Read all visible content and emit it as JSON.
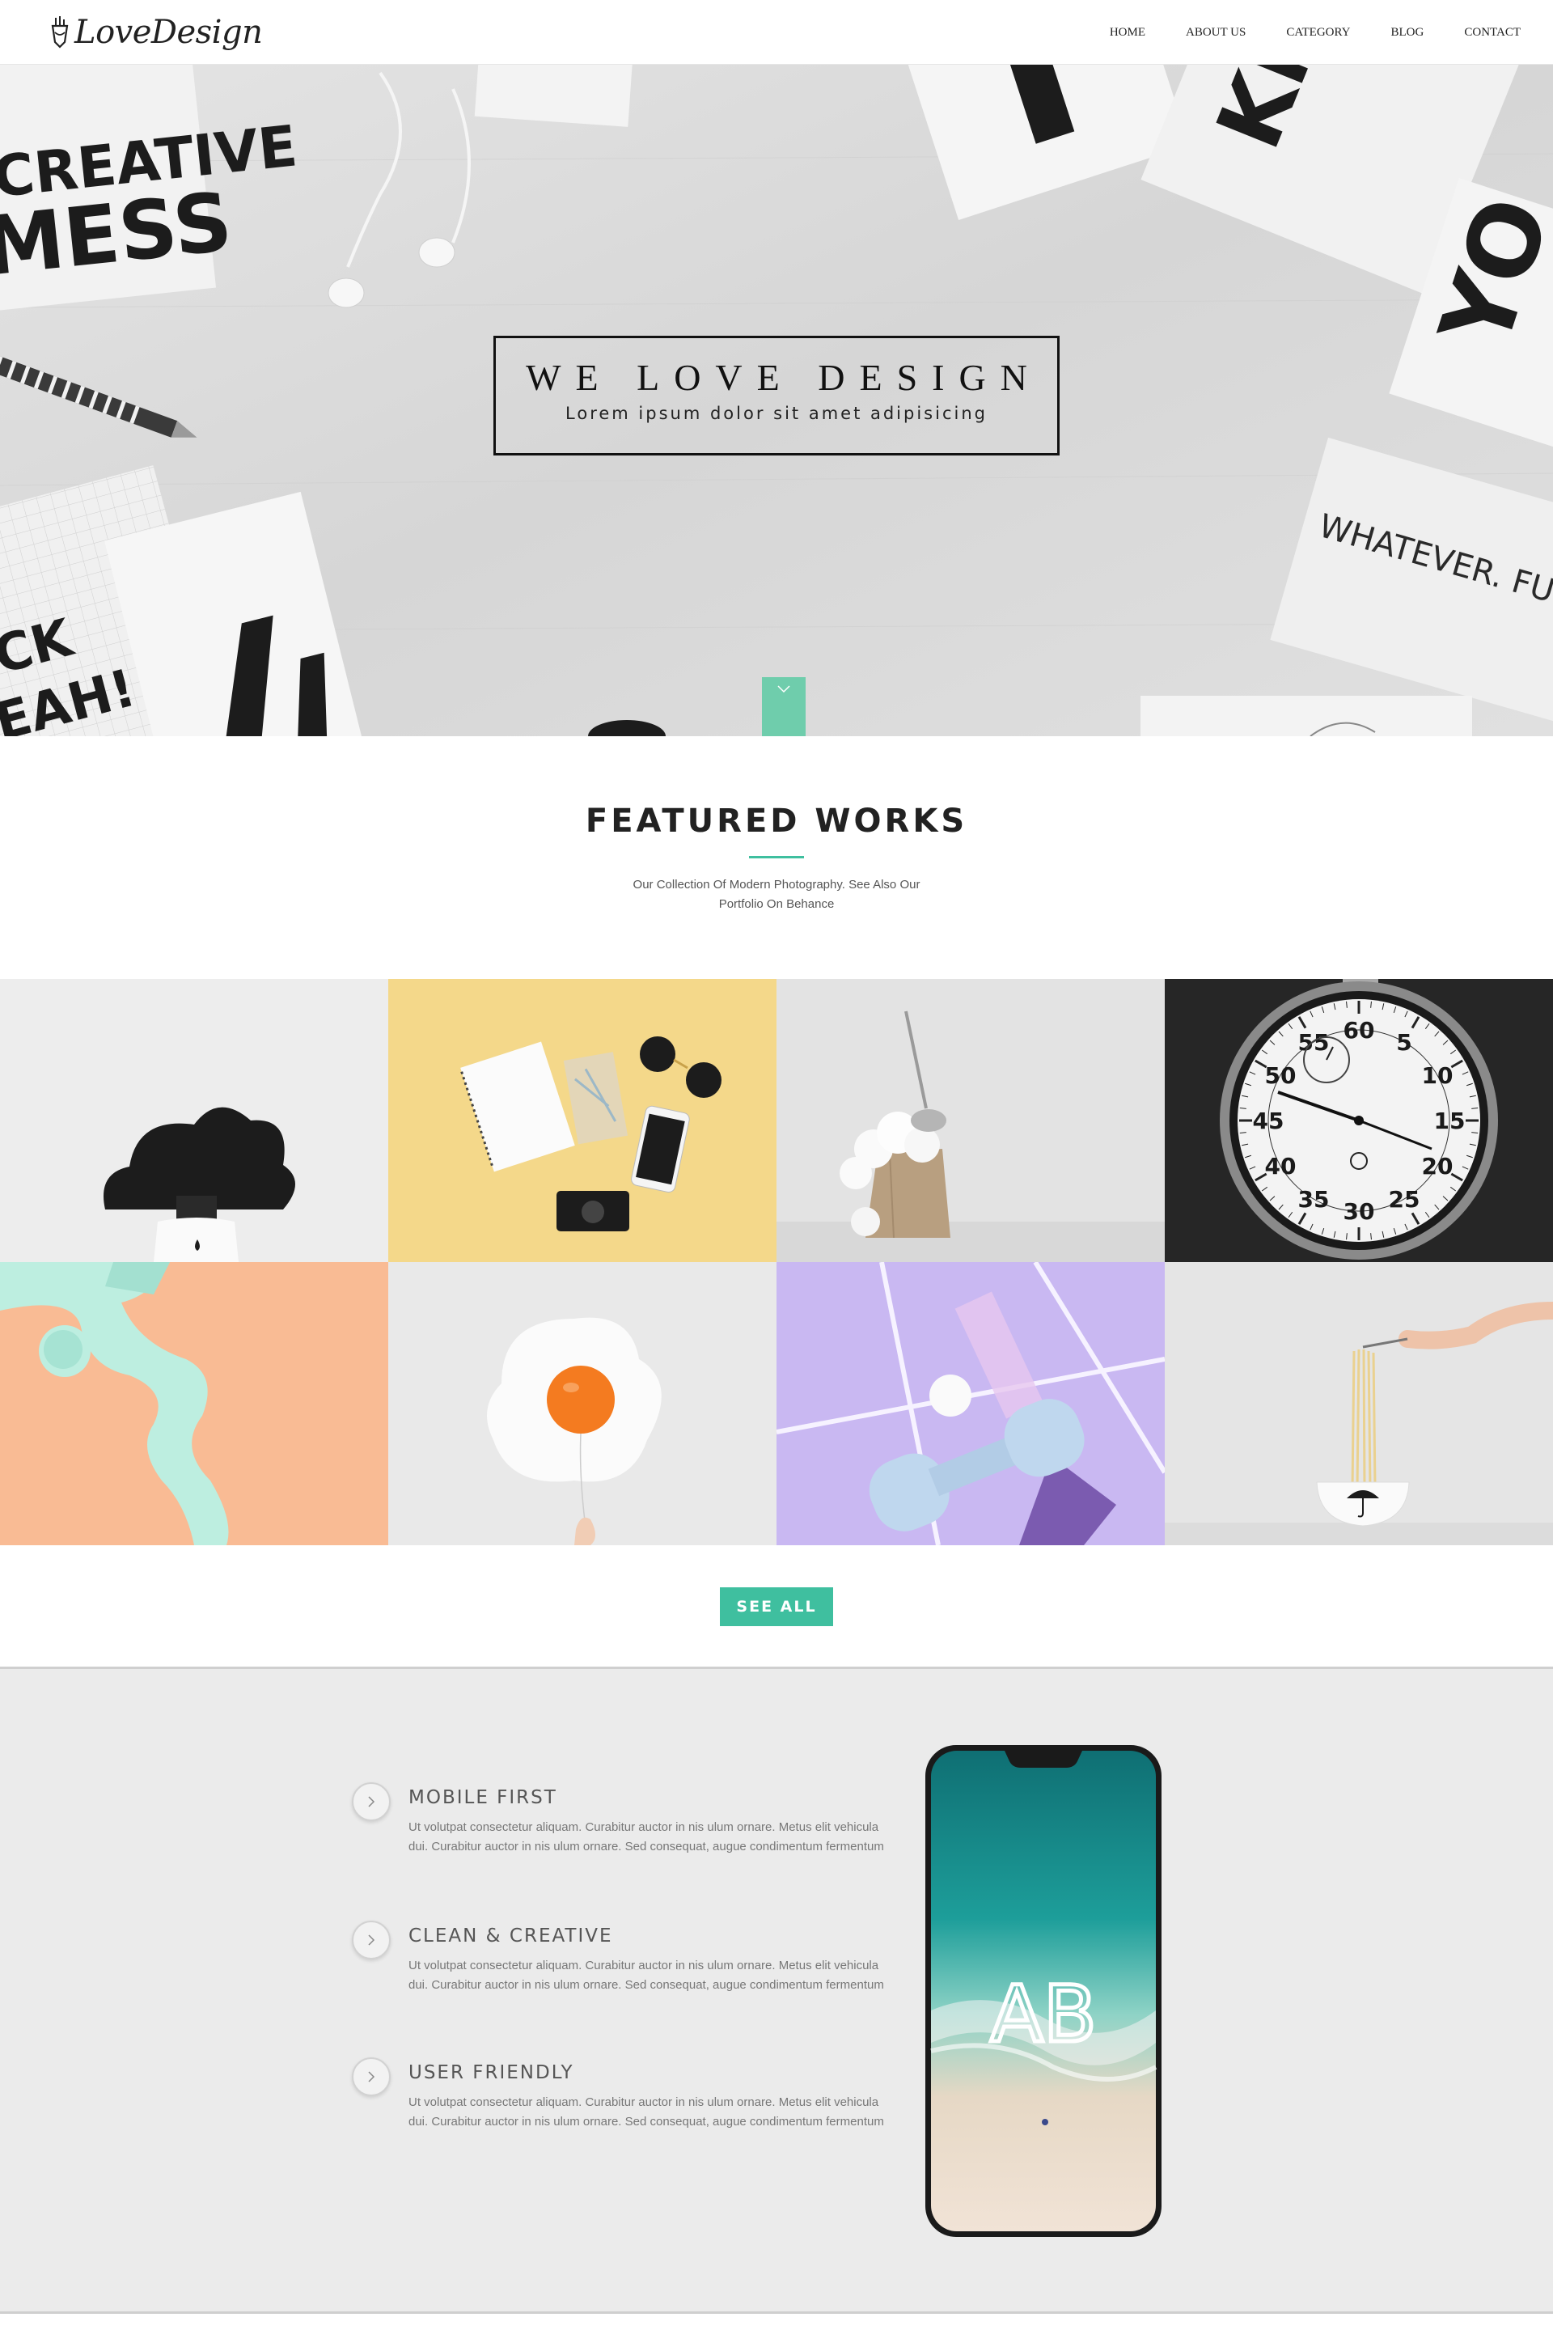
{
  "nav": {
    "logo_text": "LoveDesign",
    "items": [
      "HOME",
      "ABOUT US",
      "CATEGORY",
      "BLOG",
      "CONTACT"
    ]
  },
  "hero": {
    "title": "WE LOVE DESIGN",
    "subtitle": "Lorem ipsum dolor sit amet adipisicing",
    "poster_texts": [
      "CREATIVE",
      "MESS",
      "KNOW",
      "YO",
      "WHATEVER. FU",
      "CK",
      "EAH!"
    ],
    "scroll_color": "#6fcdac"
  },
  "featured": {
    "title": "FEATURED WORKS",
    "description": "Our Collection Of Modern Photography. See Also Our Portfolio On Behance",
    "accent": "#3fbf9f"
  },
  "gallery": {
    "stopwatch_numbers": [
      "60",
      "5",
      "10",
      "15",
      "20",
      "25",
      "30",
      "35",
      "40",
      "45",
      "50",
      "55"
    ]
  },
  "see_all": {
    "label": "SEE ALL"
  },
  "features": [
    {
      "title": "MOBILE FIRST",
      "text": "Ut volutpat consectetur aliquam. Curabitur auctor in nis ulum ornare. Metus elit vehicula dui. Curabitur auctor in nis ulum ornare. Sed consequat, augue condimentum fermentum"
    },
    {
      "title": "CLEAN & CREATIVE",
      "text": "Ut volutpat consectetur aliquam. Curabitur auctor in nis ulum ornare. Metus elit vehicula dui. Curabitur auctor in nis ulum ornare. Sed consequat, augue condimentum fermentum"
    },
    {
      "title": "USER FRIENDLY",
      "text": "Ut volutpat consectetur aliquam. Curabitur auctor in nis ulum ornare. Metus elit vehicula dui. Curabitur auctor in nis ulum ornare. Sed consequat, augue condimentum fermentum"
    }
  ],
  "phone": {
    "logo": "AB"
  }
}
